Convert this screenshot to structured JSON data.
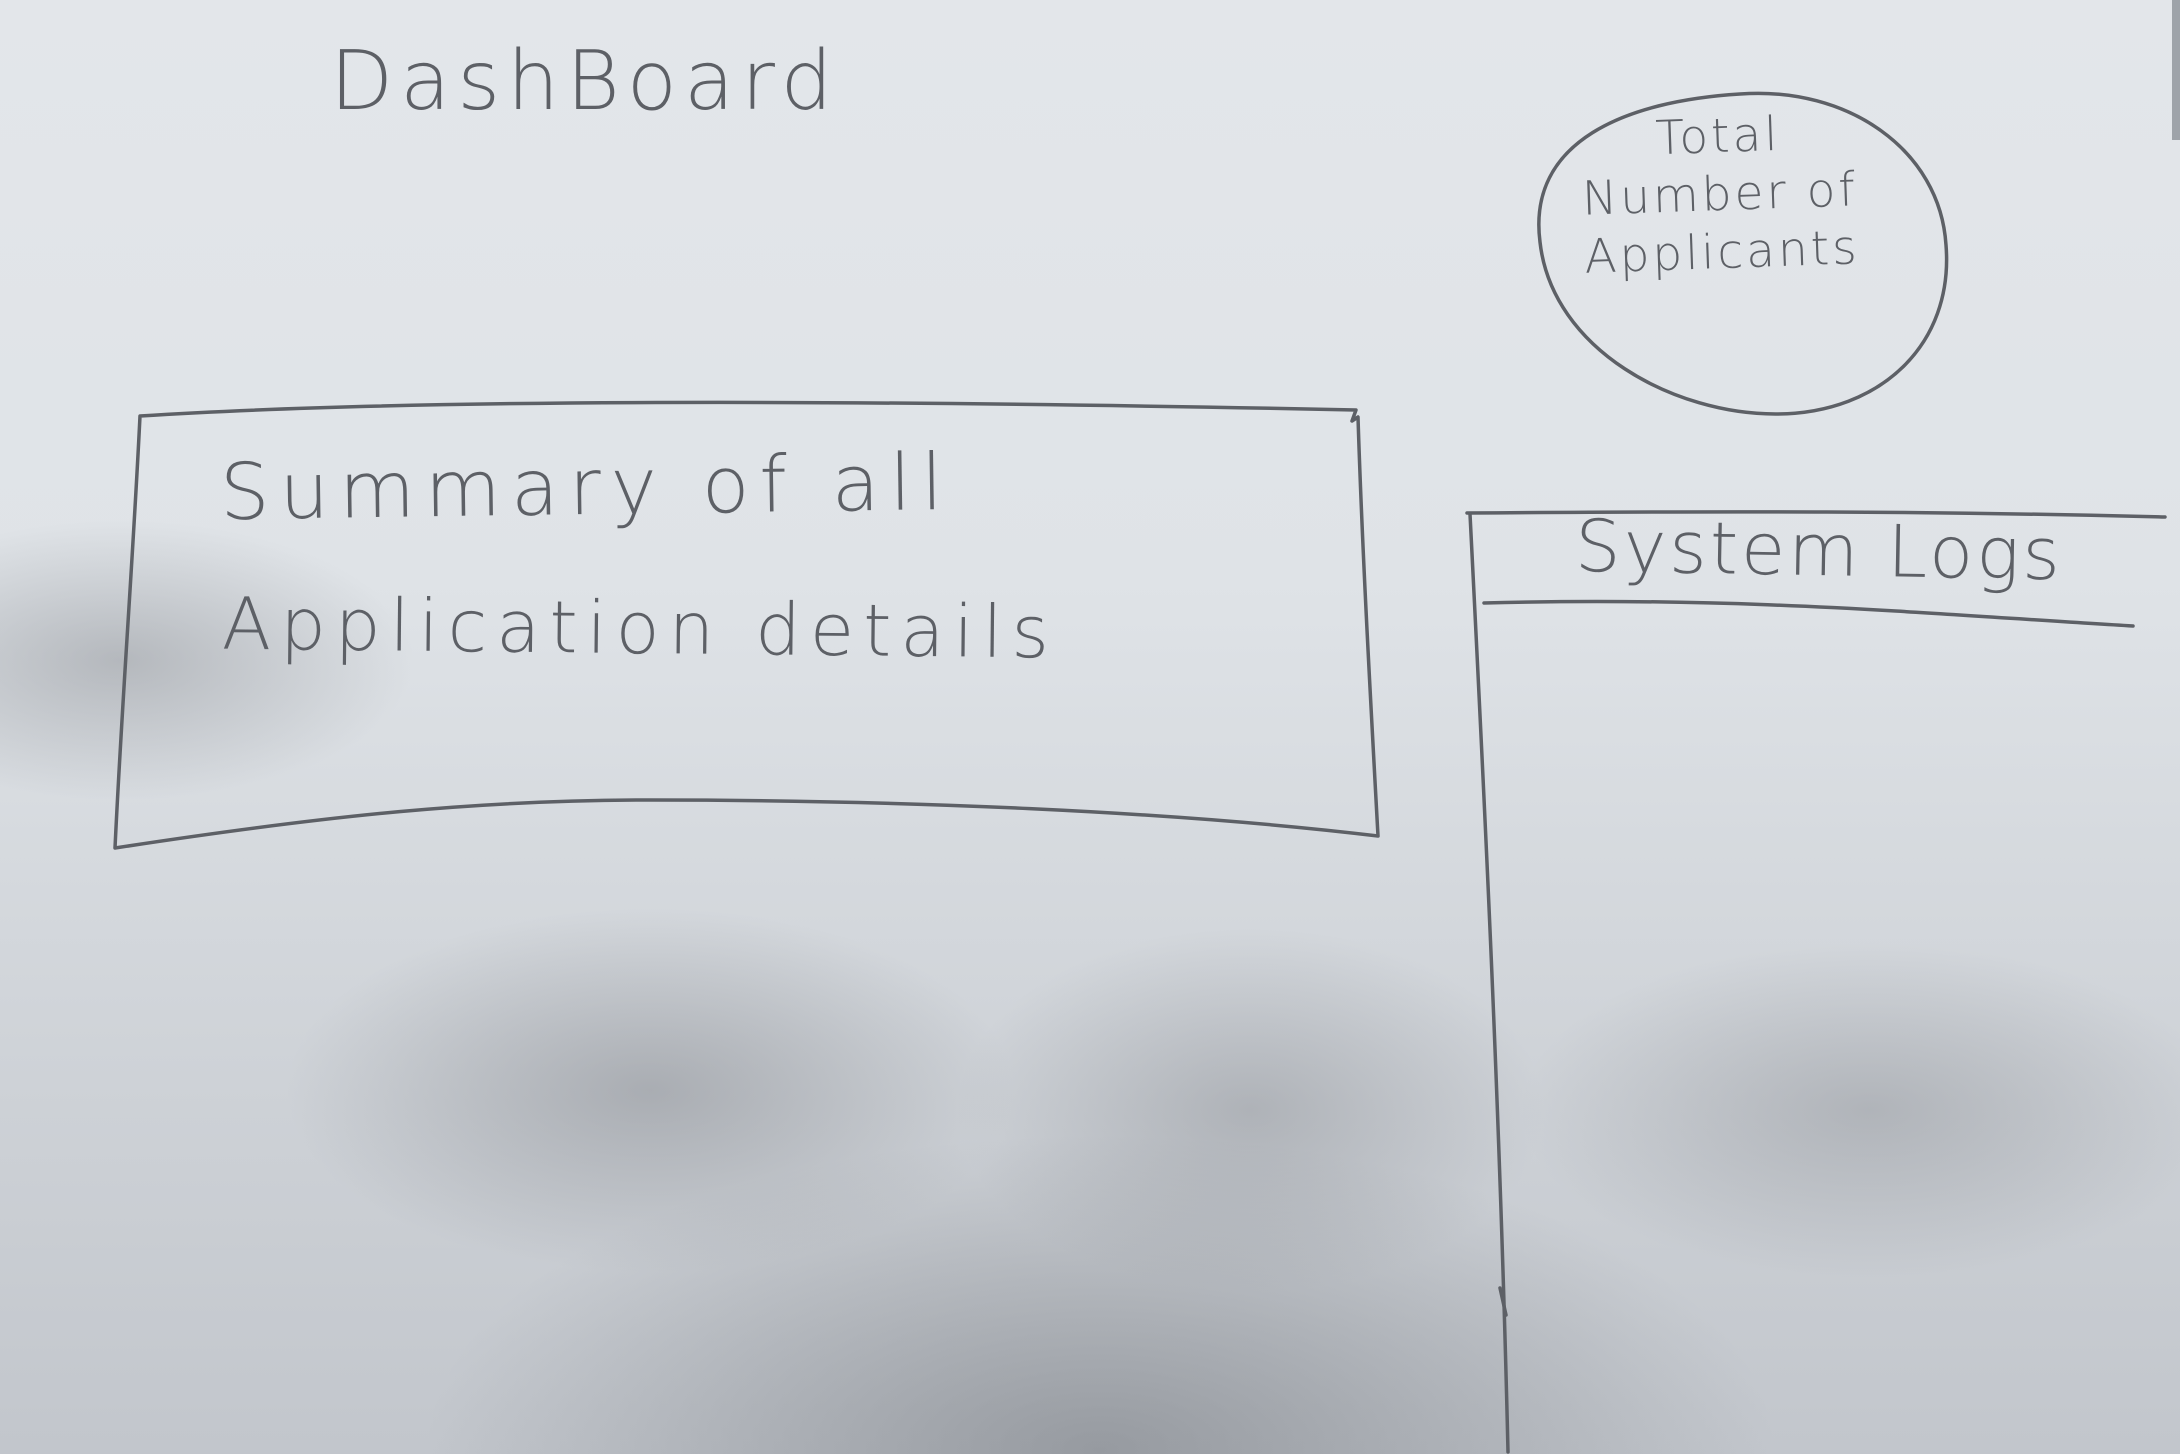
{
  "dashboard": {
    "title": "DashBoard"
  },
  "summary_card": {
    "line1": "Summary of all",
    "line2": "Application details"
  },
  "applicants_badge": {
    "text": "Total Number of Applicants"
  },
  "system_logs": {
    "title": "System Logs"
  },
  "palette": {
    "paper": "#dfe3e7",
    "shadow": "#8c9096",
    "pencil": "#5d6066"
  }
}
